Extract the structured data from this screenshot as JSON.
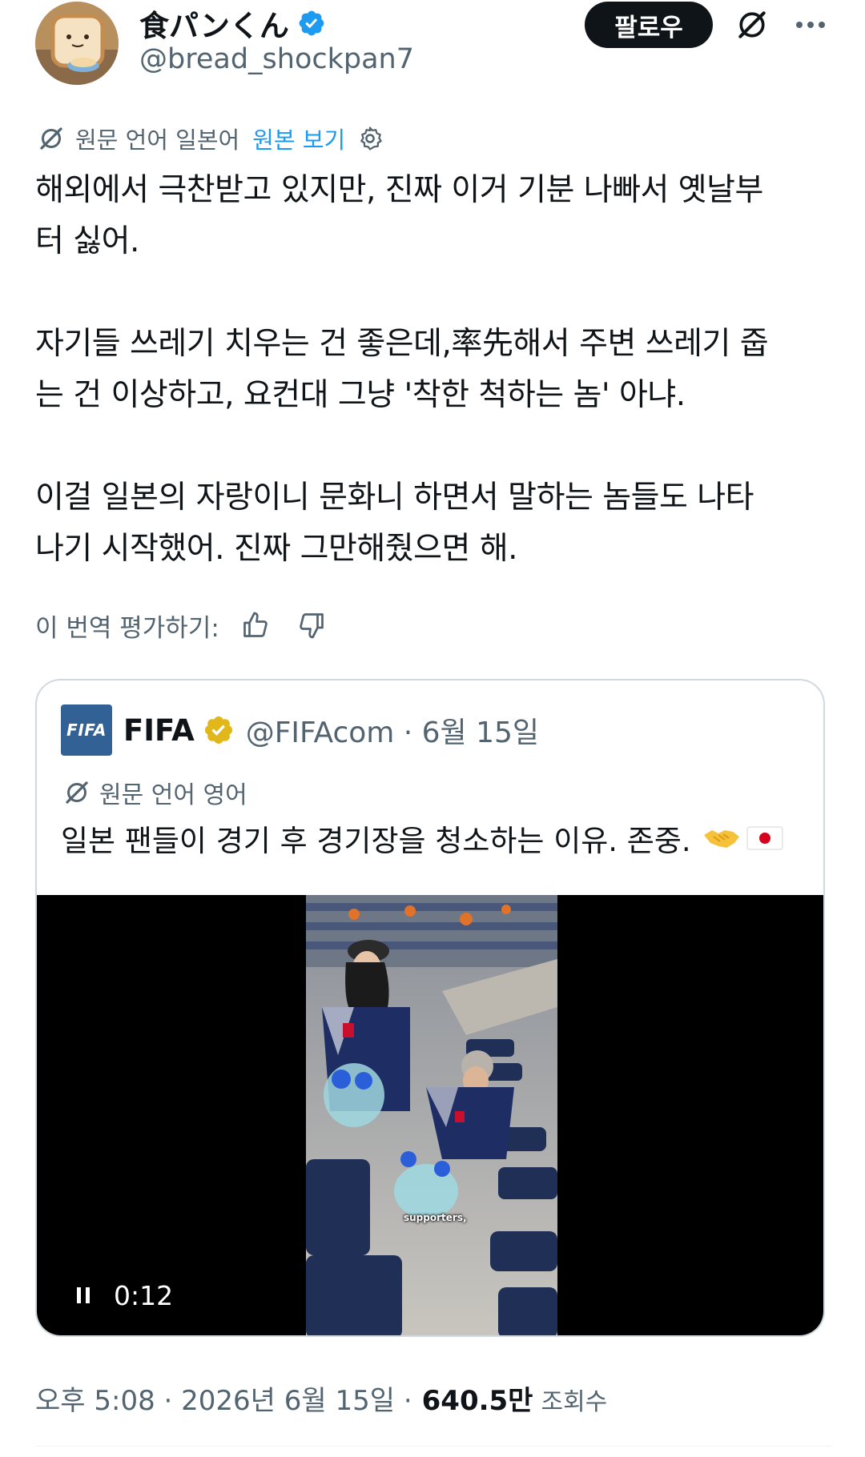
{
  "author": {
    "display_name": "食パンくん",
    "handle": "@bread_shockpan7",
    "verified_color": "#1d9bf0"
  },
  "actions": {
    "follow_label": "팔로우",
    "grok_icon": "grok-slash-icon",
    "more_icon": "more-dots-icon"
  },
  "translation": {
    "label": "원문 언어 일본어",
    "show_original": "원본 보기",
    "settings_icon": "gear-icon"
  },
  "tweet": {
    "text": "해외에서 극찬받고 있지만, 진짜 이거 기분 나빠서 옛날부\n터 싫어.\n\n자기들 쓰레기 치우는 건 좋은데,率先해서 주변 쓰레기 줍\n는 건 이상하고, 요컨대 그냥 '착한 척하는 놈' 아냐.\n\n이걸 일본의 자랑이니 문화니 하면서 말하는 놈들도 나타\n나기 시작했어. 진짜 그만해줬으면 해."
  },
  "rating": {
    "label": "이 번역 평가하기:",
    "thumbs_up_icon": "thumbs-up-icon",
    "thumbs_down_icon": "thumbs-down-icon"
  },
  "quote": {
    "logo_text": "FIFA",
    "name": "FIFA",
    "handle_date": "@FIFAcom · 6월 15일",
    "badge_color": "#e2b719",
    "translation_label": "원문 언어 영어",
    "text": "일본 팬들이 경기 후 경기장을 청소하는 이유. 존중.",
    "emojis": [
      "handshake-emoji",
      "japan-flag-emoji"
    ],
    "video": {
      "caption": "supporters,",
      "time": "0:12",
      "pause_icon": "pause-icon"
    }
  },
  "meta": {
    "timestamp": "오후 5:08 · 2026년 6월 15일 ·",
    "views": "640.5만",
    "views_label": "조회수"
  }
}
